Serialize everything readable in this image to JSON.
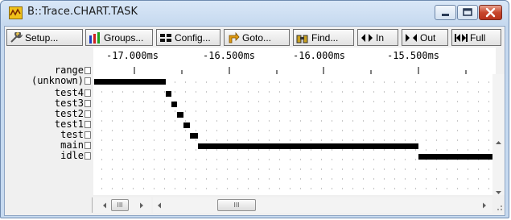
{
  "window": {
    "title": "B::Trace.CHART.TASK"
  },
  "toolbar": {
    "buttons": [
      {
        "label": "Setup...",
        "icon": "wrench-icon"
      },
      {
        "label": "Groups...",
        "icon": "groups-icon"
      },
      {
        "label": "Config...",
        "icon": "config-icon"
      },
      {
        "label": "Goto...",
        "icon": "goto-icon"
      },
      {
        "label": "Find...",
        "icon": "binoculars-icon"
      },
      {
        "label": "In",
        "icon": "zoom-in-icon"
      },
      {
        "label": "Out",
        "icon": "zoom-out-icon"
      },
      {
        "label": "Full",
        "icon": "zoom-full-icon"
      }
    ]
  },
  "ruler": {
    "ticks": [
      "-17.000ms",
      "-16.500ms",
      "-16.000ms",
      "-15.500ms"
    ]
  },
  "rows": [
    {
      "label": "range"
    },
    {
      "label": "(unknown)"
    },
    {
      "label": "test4"
    },
    {
      "label": "test3"
    },
    {
      "label": "test2"
    },
    {
      "label": "test1"
    },
    {
      "label": "test"
    },
    {
      "label": "main"
    },
    {
      "label": "idle"
    }
  ],
  "scrollbar": {
    "thumb_glyph": "III"
  },
  "colors": {
    "bar": "#000000",
    "titlebar": "#c6d9ef",
    "close_button": "#c8472d"
  }
}
